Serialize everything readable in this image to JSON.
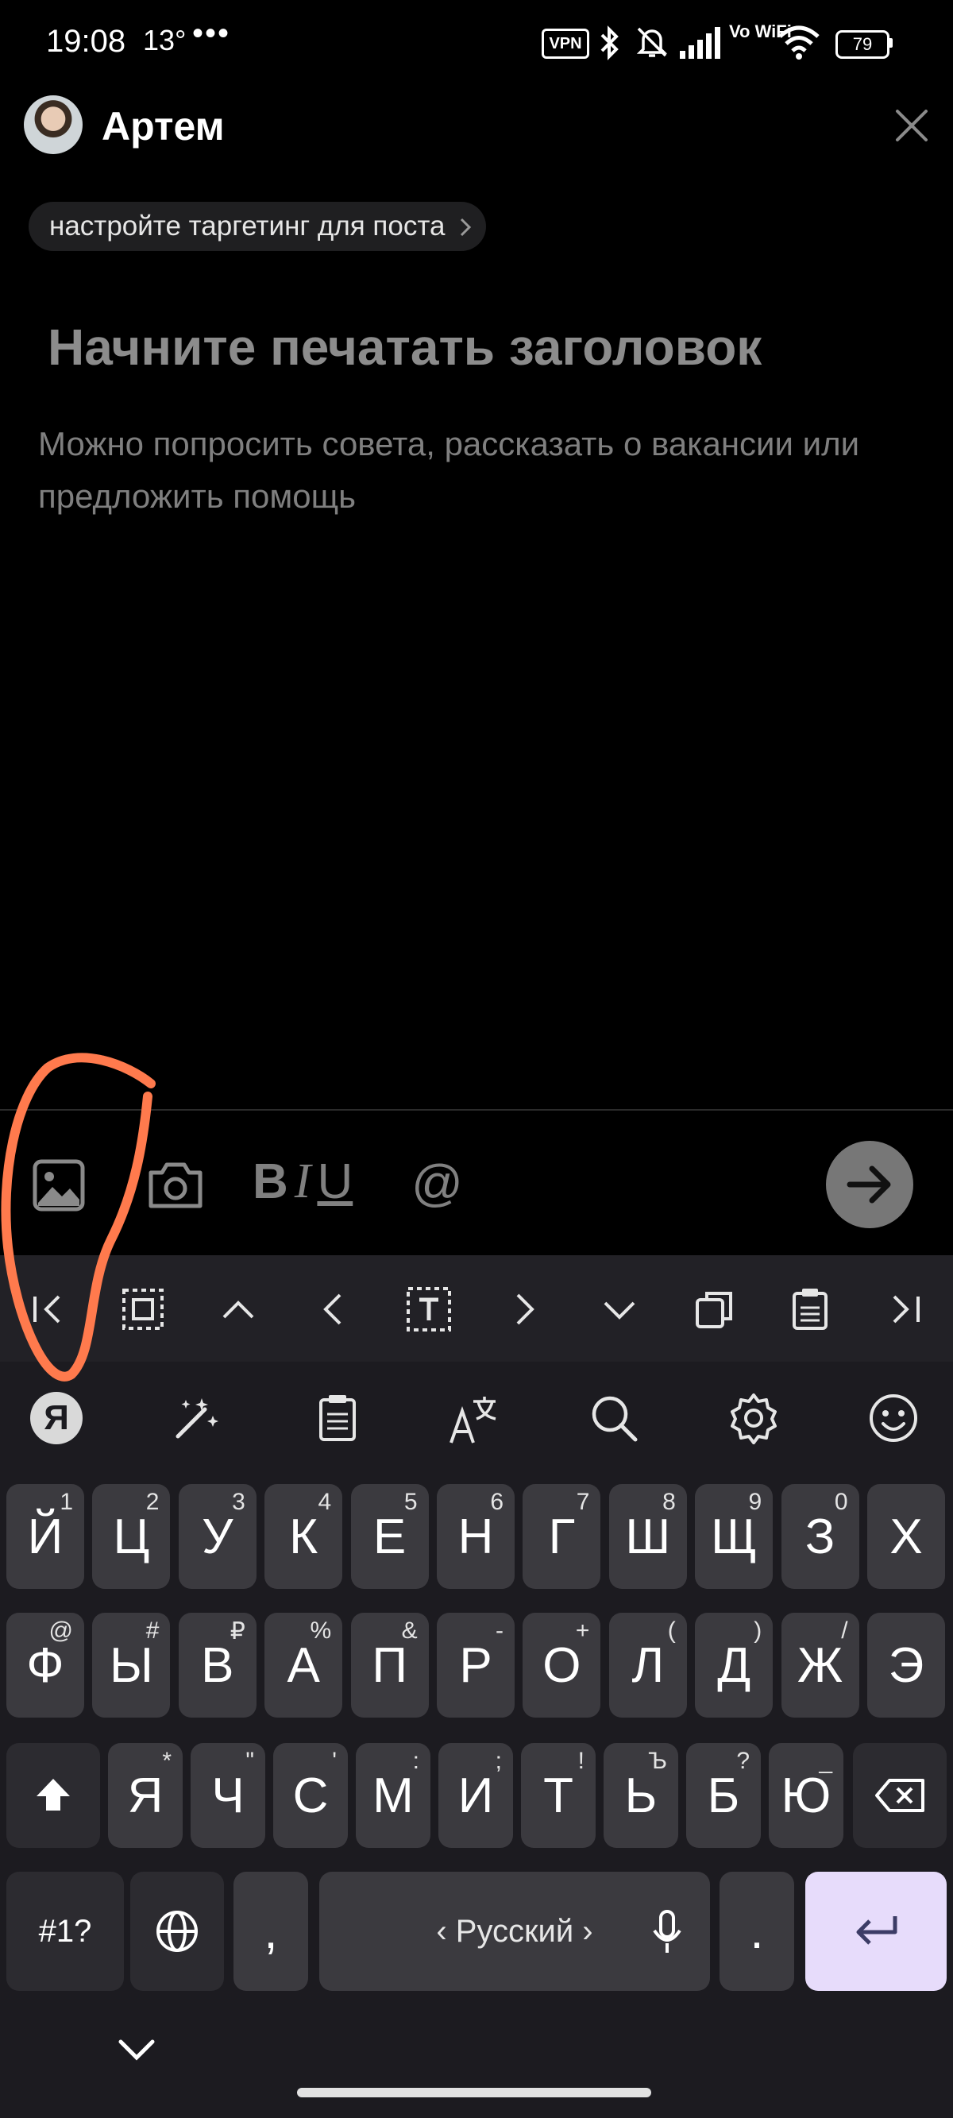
{
  "status_bar": {
    "time": "19:08",
    "extra": "13°",
    "more": "•••",
    "vpn": "VPN",
    "network": "Vo WiFi",
    "battery": "79"
  },
  "header": {
    "user_name": "Артем"
  },
  "targeting_chip": "настройте таргетинг для поста",
  "editor": {
    "title_placeholder": "Начните печатать заголовок",
    "body_placeholder": "Можно попросить совета, рассказать о вакансии или предложить помощь"
  },
  "toolbar": {
    "bold": "B",
    "italic": "I",
    "underline": "U",
    "mention": "@"
  },
  "keyboard": {
    "row1": [
      {
        "label": "Й",
        "hint": "1"
      },
      {
        "label": "Ц",
        "hint": "2"
      },
      {
        "label": "У",
        "hint": "3"
      },
      {
        "label": "К",
        "hint": "4"
      },
      {
        "label": "Е",
        "hint": "5"
      },
      {
        "label": "Н",
        "hint": "6"
      },
      {
        "label": "Г",
        "hint": "7"
      },
      {
        "label": "Ш",
        "hint": "8"
      },
      {
        "label": "Щ",
        "hint": "9"
      },
      {
        "label": "З",
        "hint": "0"
      },
      {
        "label": "Х",
        "hint": ""
      }
    ],
    "row2": [
      {
        "label": "Ф",
        "hint": "@"
      },
      {
        "label": "Ы",
        "hint": "#"
      },
      {
        "label": "В",
        "hint": "₽"
      },
      {
        "label": "А",
        "hint": "%"
      },
      {
        "label": "П",
        "hint": "&"
      },
      {
        "label": "Р",
        "hint": "-"
      },
      {
        "label": "О",
        "hint": "+"
      },
      {
        "label": "Л",
        "hint": "("
      },
      {
        "label": "Д",
        "hint": ")"
      },
      {
        "label": "Ж",
        "hint": "/"
      },
      {
        "label": "Э",
        "hint": ""
      }
    ],
    "row3": [
      {
        "label": "Я",
        "hint": "*"
      },
      {
        "label": "Ч",
        "hint": "\""
      },
      {
        "label": "С",
        "hint": "'"
      },
      {
        "label": "М",
        "hint": ":"
      },
      {
        "label": "И",
        "hint": ";"
      },
      {
        "label": "Т",
        "hint": "!"
      },
      {
        "label": "Ь",
        "hint": "Ъ"
      },
      {
        "label": "Б",
        "hint": "?"
      },
      {
        "label": "Ю",
        "hint": "_"
      }
    ],
    "symbols_label": "#1?",
    "comma": ",",
    "space_label": "‹ Русский ›",
    "period": "."
  },
  "colors": {
    "background": "#000000",
    "keyboard_bg": "#1c1b20",
    "key": "#3b3a3f",
    "enter_key": "#e7dcfb",
    "annotation": "#ff7a4d"
  }
}
